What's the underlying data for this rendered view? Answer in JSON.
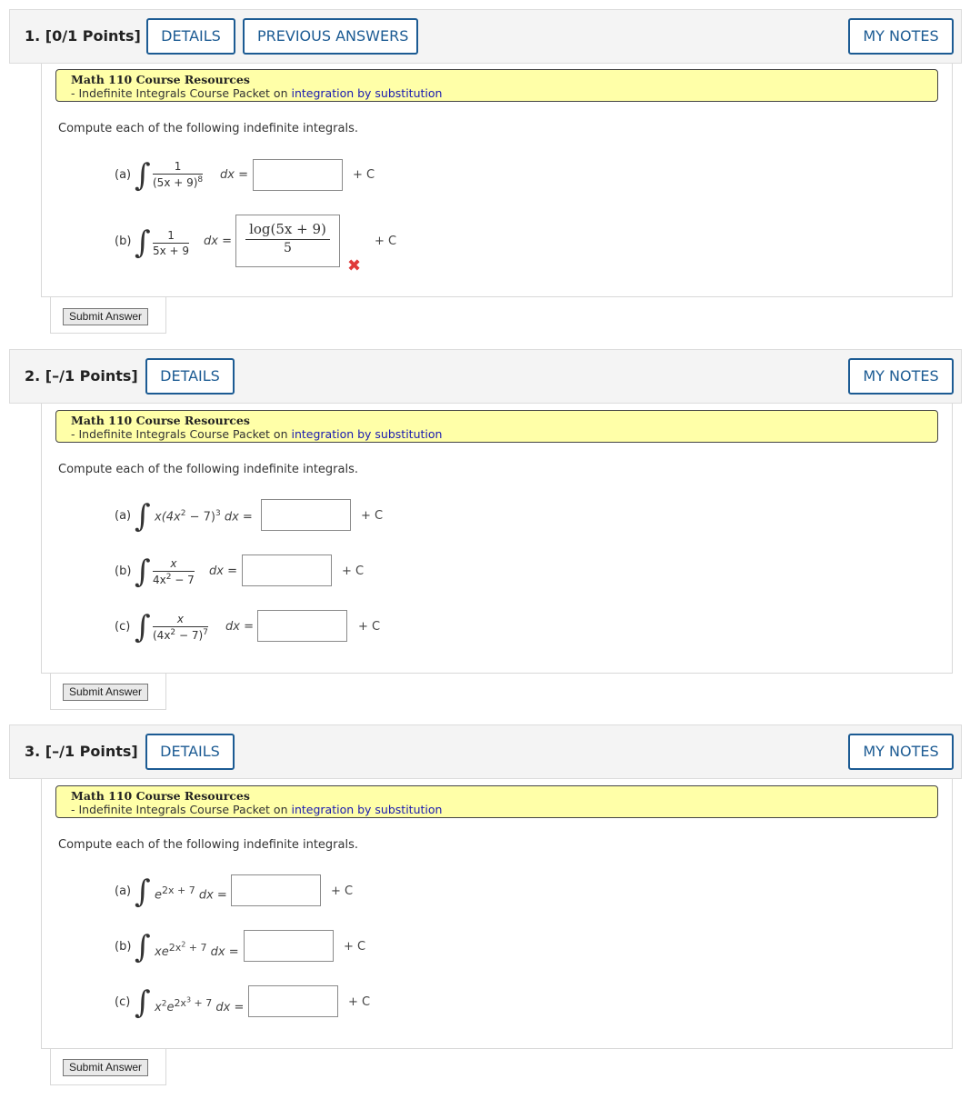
{
  "questions": [
    {
      "title": "1.  [0/1 Points]",
      "buttons": {
        "details": "DETAILS",
        "previous": "PREVIOUS ANSWERS",
        "notes": "MY NOTES"
      },
      "resources": {
        "title": "Math 110 Course Resources",
        "prefix": "- Indefinite Integrals Course Packet on ",
        "link": "integration by substitution"
      },
      "instruction": "Compute each of the following indefinite integrals.",
      "parts": [
        {
          "label": "(a)",
          "num": "1",
          "den": "(5x + 9)",
          "den_exp": "8",
          "dx": "dx =",
          "plus_c": "+ C",
          "answer": ""
        },
        {
          "label": "(b)",
          "num": "1",
          "den": "5x + 9",
          "dx": "dx =",
          "plus_c": "+ C",
          "answer_num": "log(5x + 9)",
          "answer_den": "5",
          "status": "incorrect"
        }
      ],
      "submit": "Submit Answer"
    },
    {
      "title": "2.  [–/1 Points]",
      "buttons": {
        "details": "DETAILS",
        "notes": "MY NOTES"
      },
      "resources": {
        "title": "Math 110 Course Resources",
        "prefix": "- Indefinite Integrals Course Packet on ",
        "link": "integration by substitution"
      },
      "instruction": "Compute each of the following indefinite integrals.",
      "parts": [
        {
          "label": "(a)",
          "expr": "x(4x",
          "exp1": "2",
          "mid": " − 7)",
          "exp2": "3",
          "dx": " dx =",
          "plus_c": "+ C"
        },
        {
          "label": "(b)",
          "num": "x",
          "den": "4x",
          "den_exp": "2",
          "den_tail": " − 7",
          "dx": "dx =",
          "plus_c": "+ C"
        },
        {
          "label": "(c)",
          "num": "x",
          "den": "(4x",
          "den_exp": "2",
          "den_tail": " − 7)",
          "den_exp2": "7",
          "dx": "dx =",
          "plus_c": "+ C"
        }
      ],
      "submit": "Submit Answer"
    },
    {
      "title": "3.  [–/1 Points]",
      "buttons": {
        "details": "DETAILS",
        "notes": "MY NOTES"
      },
      "resources": {
        "title": "Math 110 Course Resources",
        "prefix": "- Indefinite Integrals Course Packet on ",
        "link": "integration by substitution"
      },
      "instruction": "Compute each of the following indefinite integrals.",
      "parts": [
        {
          "label": "(a)",
          "base": "e",
          "exp": "2x + 7",
          "dx": " dx =",
          "plus_c": "+ C"
        },
        {
          "label": "(b)",
          "base": "xe",
          "exp": "2x",
          "exp2": "2",
          "exp_tail": " + 7",
          "dx": " dx =",
          "plus_c": "+ C"
        },
        {
          "label": "(c)",
          "base": "x",
          "base_exp": "2",
          "base2": "e",
          "exp": "2x",
          "exp2": "3",
          "exp_tail": " + 7",
          "dx": " dx =",
          "plus_c": "+ C"
        }
      ],
      "submit": "Submit Answer"
    }
  ]
}
